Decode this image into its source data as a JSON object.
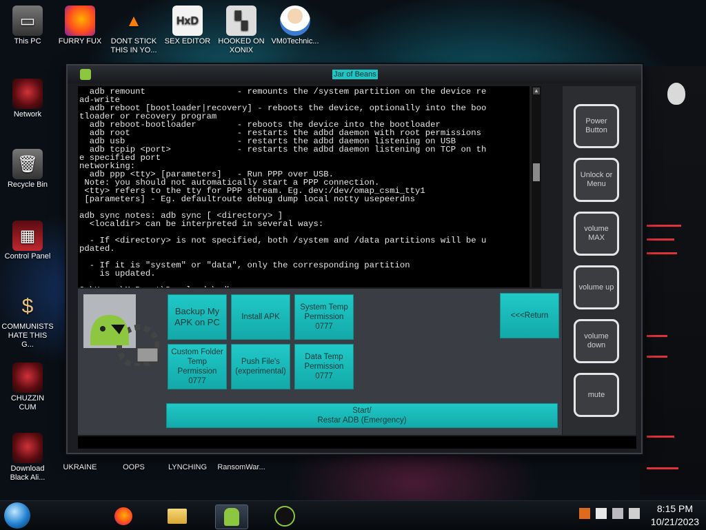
{
  "desktop": {
    "icons": [
      {
        "label": "This PC"
      },
      {
        "label": "FURRY FUX"
      },
      {
        "label": "DONT STICK THIS IN YO..."
      },
      {
        "label": "SEX EDITOR"
      },
      {
        "label": "HOOKED ON XONIX"
      },
      {
        "label": "VM0Technic..."
      },
      {
        "label": "Network"
      },
      {
        "label": "Recycle Bin"
      },
      {
        "label": "Control Panel"
      },
      {
        "label": "COMMUNISTS HATE THIS G..."
      },
      {
        "label": "CHUZZIN CUM"
      },
      {
        "label": "Download Black Ali..."
      },
      {
        "label": "UKRAINE"
      },
      {
        "label": "OOPS"
      },
      {
        "label": "LYNCHING"
      },
      {
        "label": "RansomWar..."
      }
    ]
  },
  "window": {
    "title": "Jar of Beans",
    "console_text": "  adb remount                  - remounts the /system partition on the device re\nad-write\n  adb reboot [bootloader|recovery] - reboots the device, optionally into the boo\ntloader or recovery program\n  adb reboot-bootloader        - reboots the device into the bootloader\n  adb root                     - restarts the adbd daemon with root permissions\n  adb usb                      - restarts the adbd daemon listening on USB\n  adb tcpip <port>             - restarts the adbd daemon listening on TCP on th\ne specified port\nnetworking:\n  adb ppp <tty> [parameters]   - Run PPP over USB.\n Note: you should not automatically start a PPP connection.\n <tty> refers to the tty for PPP stream. Eg. dev:/dev/omap_csmi_tty1\n [parameters] - Eg. defaultroute debug dump local notty usepeerdns\n\nadb sync notes: adb sync [ <directory> ]\n  <localdir> can be interpreted in several ways:\n\n  - If <directory> is not specified, both /system and /data partitions will be u\npdated.\n\n  - If it is \"system\" or \"data\", only the corresponding partition\n    is updated.\n\nC:\\Users\\M_Beast\\Downloads\\adb>",
    "buttons": {
      "backup": "Backup My APK on PC",
      "install": "Install APK",
      "system_temp": "System Temp Permission 0777",
      "custom_folder": "Custom Folder Temp Permission 0777",
      "push_files": "Push File's (experimental)",
      "data_temp": "Data Temp Permission 0777",
      "return": "<<<Return",
      "start": "Start/",
      "start_sub": "Restar ADB (Emergency)"
    },
    "side_buttons": {
      "power": "Power Button",
      "unlock": "Unlock or Menu",
      "vol_max": "volume MAX",
      "vol_up": "volume up",
      "vol_down": "volume down",
      "mute": "mute"
    }
  },
  "taskbar": {
    "time": "8:15 PM",
    "date": "10/21/2023"
  }
}
